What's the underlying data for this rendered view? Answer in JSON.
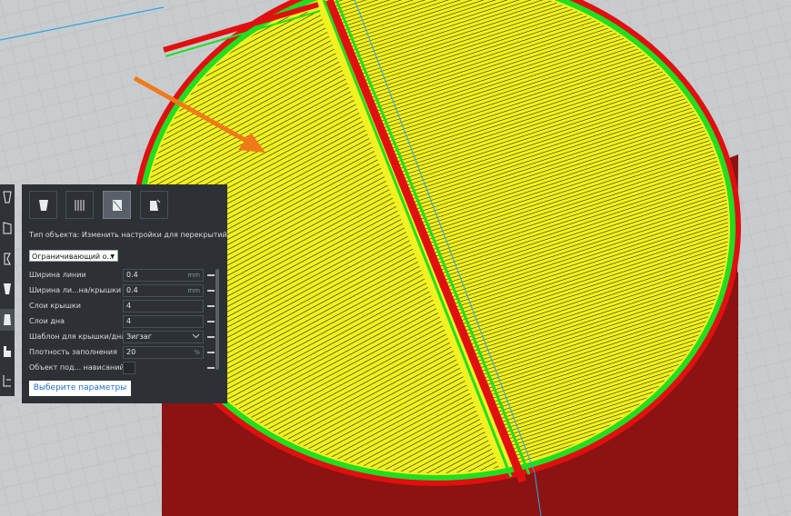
{
  "panel": {
    "description": "Тип объекта: Изменить настройки для перекрытий",
    "mesh_type_select": "Ограничивающий о...",
    "settings": [
      {
        "label": "Ширина линии",
        "value": "0.4",
        "unit": "mm"
      },
      {
        "label": "Ширина ли...на/крышки",
        "value": "0.4",
        "unit": "mm"
      },
      {
        "label": "Слои крышки",
        "value": "4",
        "unit": ""
      },
      {
        "label": "Слои дна",
        "value": "4",
        "unit": ""
      },
      {
        "label": "Шаблон для крышки/дна",
        "value": "Зигзаг",
        "unit": ""
      },
      {
        "label": "Плотность заполнения",
        "value": "20",
        "unit": "%"
      },
      {
        "label": "Объект под... нависаний",
        "value": "",
        "unit": ""
      }
    ],
    "select_settings_button": "Выберите параметры"
  },
  "mode_icons": [
    "normal-model-icon",
    "print-as-support-icon",
    "modify-settings-for-overlaps-icon",
    "dont-support-overlaps-icon"
  ],
  "toolbar_icons": [
    "move-icon",
    "scale-icon",
    "rotate-icon",
    "mirror-icon",
    "per-model-settings-icon",
    "support-blocker-icon",
    "layers-icon"
  ],
  "colors": {
    "build_plate": "#c9cccf",
    "model_body": "#8b1313",
    "wall_outer": "#e01010",
    "wall_inner": "#22dd22",
    "top_skin": "#f2f220",
    "skin_line": "#2a2a00",
    "arrow": "#f07a1a",
    "panel_bg": "#2d3135",
    "button_text": "#1d6fcc"
  }
}
